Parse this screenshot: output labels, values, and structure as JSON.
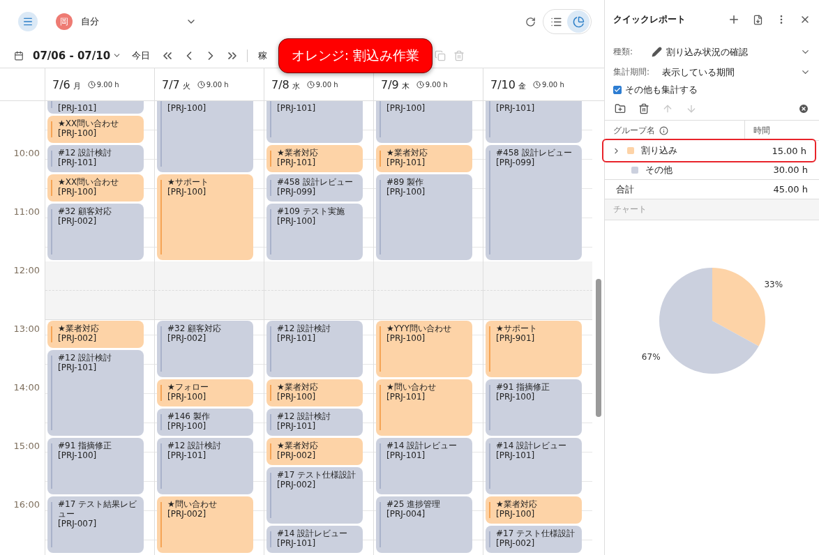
{
  "user": {
    "avatar": "岡",
    "name": "自分"
  },
  "view_toggle": [
    {
      "kind": "list",
      "selected": false
    },
    {
      "kind": "chart",
      "selected": true
    }
  ],
  "toolbar": {
    "range": "07/06 - 07/10",
    "today": "今日",
    "cut_label": "稼"
  },
  "callout": {
    "text": "オレンジ: 割込み作業"
  },
  "time_labels": [
    "10:00",
    "11:00",
    "12:00",
    "13:00",
    "14:00",
    "15:00",
    "16:00"
  ],
  "days": [
    {
      "date": "7/6",
      "weekday": "月",
      "hours": "9.00 h",
      "slots": [
        {
          "kind": "task",
          "project": "[PRJ-101]"
        },
        {
          "kind": "interrupt",
          "title": "★XX問い合わせ",
          "project": "[PRJ-100]"
        },
        {
          "kind": "task",
          "title": "#12 設計検討",
          "project": "[PRJ-101]"
        },
        {
          "kind": "interrupt",
          "title": "★XX問い合わせ",
          "project": "[PRJ-100]"
        },
        {
          "kind": "task",
          "title": "#32 顧客対応",
          "project": "[PRJ-002]"
        },
        {
          "kind": "continued"
        },
        {
          "kind": "break"
        },
        {
          "kind": "break"
        },
        {
          "kind": "interrupt",
          "title": "★業者対応",
          "project": "[PRJ-002]"
        },
        {
          "kind": "task",
          "title": "#12 設計検討",
          "project": "[PRJ-101]"
        },
        {
          "kind": "continued"
        },
        {
          "kind": "continued"
        },
        {
          "kind": "task",
          "title": "#91 指摘修正",
          "project": "[PRJ-100]"
        },
        {
          "kind": "continued"
        },
        {
          "kind": "task",
          "title": "#17 テスト結果レビュー",
          "project": "[PRJ-007]"
        },
        {
          "kind": "continued"
        }
      ]
    },
    {
      "date": "7/7",
      "weekday": "火",
      "hours": "9.00 h",
      "slots": [
        {
          "kind": "task",
          "project": "[PRJ-100]"
        },
        {
          "kind": "continued"
        },
        {
          "kind": "continued"
        },
        {
          "kind": "interrupt",
          "title": "★サポート",
          "project": "[PRJ-100]"
        },
        {
          "kind": "continued"
        },
        {
          "kind": "continued"
        },
        {
          "kind": "break"
        },
        {
          "kind": "break"
        },
        {
          "kind": "task",
          "title": "#32 顧客対応",
          "project": "[PRJ-002]"
        },
        {
          "kind": "continued"
        },
        {
          "kind": "interrupt",
          "title": "★フォロー",
          "project": "[PRJ-100]"
        },
        {
          "kind": "task",
          "title": "#146 製作",
          "project": "[PRJ-100]"
        },
        {
          "kind": "task",
          "title": "#12 設計検討",
          "project": "[PRJ-101]"
        },
        {
          "kind": "continued"
        },
        {
          "kind": "interrupt",
          "title": "★問い合わせ",
          "project": "[PRJ-002]"
        },
        {
          "kind": "continued"
        }
      ]
    },
    {
      "date": "7/8",
      "weekday": "水",
      "hours": "9.00 h",
      "slots": [
        {
          "kind": "task",
          "project": "[PRJ-101]"
        },
        {
          "kind": "continued"
        },
        {
          "kind": "interrupt",
          "title": "★業者対応",
          "project": "[PRJ-101]"
        },
        {
          "kind": "task",
          "title": "#458 設計レビュー",
          "project": "[PRJ-099]"
        },
        {
          "kind": "task",
          "title": "#109 テスト実施",
          "project": "[PRJ-100]"
        },
        {
          "kind": "continued"
        },
        {
          "kind": "break"
        },
        {
          "kind": "break"
        },
        {
          "kind": "task",
          "title": "#12 設計検討",
          "project": "[PRJ-101]"
        },
        {
          "kind": "continued"
        },
        {
          "kind": "interrupt",
          "title": "★業者対応",
          "project": "[PRJ-100]"
        },
        {
          "kind": "task",
          "title": "#12 設計検討",
          "project": "[PRJ-101]"
        },
        {
          "kind": "interrupt",
          "title": "★業者対応",
          "project": "[PRJ-002]"
        },
        {
          "kind": "task",
          "title": "#17 テスト仕様設計",
          "project": "[PRJ-002]"
        },
        {
          "kind": "continued"
        },
        {
          "kind": "task",
          "title": "#14 設計レビュー",
          "project": "[PRJ-101]"
        }
      ]
    },
    {
      "date": "7/9",
      "weekday": "木",
      "hours": "9.00 h",
      "slots": [
        {
          "kind": "task",
          "project": "[PRJ-100]"
        },
        {
          "kind": "continued"
        },
        {
          "kind": "interrupt",
          "title": "★業者対応",
          "project": "[PRJ-101]"
        },
        {
          "kind": "task",
          "title": "#89 製作",
          "project": "[PRJ-100]"
        },
        {
          "kind": "continued"
        },
        {
          "kind": "continued"
        },
        {
          "kind": "break"
        },
        {
          "kind": "break"
        },
        {
          "kind": "interrupt",
          "title": "★YYY問い合わせ",
          "project": "[PRJ-100]"
        },
        {
          "kind": "continued"
        },
        {
          "kind": "interrupt",
          "title": "★問い合わせ",
          "project": "[PRJ-101]"
        },
        {
          "kind": "continued"
        },
        {
          "kind": "task",
          "title": "#14 設計レビュー",
          "project": "[PRJ-101]"
        },
        {
          "kind": "continued"
        },
        {
          "kind": "task",
          "title": "#25 進捗管理",
          "project": "[PRJ-004]"
        },
        {
          "kind": "continued"
        }
      ]
    },
    {
      "date": "7/10",
      "weekday": "金",
      "hours": "9.00 h",
      "slots": [
        {
          "kind": "task",
          "project": "[PRJ-101]"
        },
        {
          "kind": "continued"
        },
        {
          "kind": "task",
          "title": "#458 設計レビュー",
          "project": "[PRJ-099]"
        },
        {
          "kind": "continued"
        },
        {
          "kind": "continued"
        },
        {
          "kind": "continued"
        },
        {
          "kind": "break"
        },
        {
          "kind": "break"
        },
        {
          "kind": "interrupt",
          "title": "★サポート",
          "project": "[PRJ-901]"
        },
        {
          "kind": "continued"
        },
        {
          "kind": "task",
          "title": "#91 指摘修正",
          "project": "[PRJ-100]"
        },
        {
          "kind": "continued"
        },
        {
          "kind": "task",
          "title": "#14 設計レビュー",
          "project": "[PRJ-101]"
        },
        {
          "kind": "continued"
        },
        {
          "kind": "interrupt",
          "title": "★業者対応",
          "project": "[PRJ-100]"
        },
        {
          "kind": "task",
          "title": "#17 テスト仕様設計",
          "project": "[PRJ-002]"
        }
      ]
    }
  ],
  "report": {
    "title": "クイックレポート",
    "fields": [
      {
        "kind": "preset",
        "label": "種類:",
        "value": "割り込み状況の確認"
      },
      {
        "kind": "plain",
        "label": "集計期間:",
        "value": "表示している期間"
      }
    ],
    "include_others": {
      "label": "その他も集計する",
      "checked": true
    },
    "tools": [
      {
        "kind": "add-folder",
        "disabled": false
      },
      {
        "kind": "delete",
        "disabled": false
      },
      {
        "kind": "up",
        "disabled": true
      },
      {
        "kind": "down",
        "disabled": true
      }
    ],
    "columns": [
      "グループ名",
      "時間"
    ],
    "groups": [
      {
        "name": "割り込み",
        "hours": "15.00 h",
        "color": "#fdd3a7",
        "expandable": true,
        "highlighted": true
      },
      {
        "name": "その他",
        "hours": "30.00 h",
        "color": "#cbd0de",
        "expandable": false,
        "highlighted": false
      }
    ],
    "total": {
      "label": "合計",
      "hours": "45.00 h"
    },
    "chart_section": "チャート",
    "chart_data": {
      "type": "pie",
      "series": [
        {
          "values": [
            33,
            67
          ]
        }
      ],
      "value_labels": [
        "33%",
        "67%"
      ]
    }
  }
}
